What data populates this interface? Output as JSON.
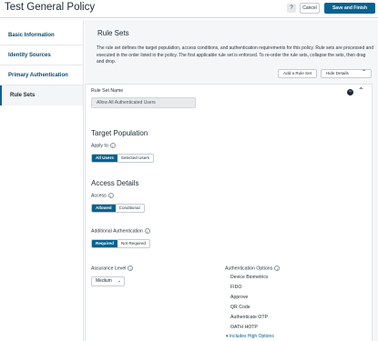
{
  "header": {
    "title": "Test General Policy",
    "help_label": "?",
    "cancel_label": "Cancel",
    "save_label": "Save and Finish"
  },
  "sidebar": {
    "items": [
      {
        "label": "Basic Information"
      },
      {
        "label": "Identity Sources"
      },
      {
        "label": "Primary Authentication"
      },
      {
        "label": "Rule Sets"
      }
    ],
    "active": "Rule Sets"
  },
  "main": {
    "title": "Rule Sets",
    "description": "The rule set defines the target population, access conditions, and authentication requirements for this policy. Rule sets are processed and executed in the order listed in the policy. The first applicable rule set is enforced. To re-order the rule sets, collapse the sets, then drag and drop.",
    "add_rule_set_label": "Add a Rule Set",
    "hide_details_label": "Hide Details"
  },
  "rule_set": {
    "name_label": "Rule Set Name",
    "name_value": "Allow All Authenticated Users",
    "target_population": {
      "heading": "Target Population",
      "apply_to_label": "Apply to",
      "options": [
        "All Users",
        "Selected Users"
      ],
      "selected": "All Users"
    },
    "access_details": {
      "heading": "Access Details",
      "access_label": "Access",
      "access_options": [
        "Allowed",
        "Conditional"
      ],
      "access_selected": "Allowed",
      "additional_auth_label": "Additional Authentication",
      "additional_auth_options": [
        "Required",
        "Not Required"
      ],
      "additional_auth_selected": "Required",
      "assurance_label": "Assurance Level",
      "assurance_value": "Medium",
      "auth_options_label": "Authentication Options",
      "auth_options": [
        "Device Biometrics",
        "FIDO",
        "Approve",
        "QR Code",
        "Authenticate OTP",
        "OATH HOTP"
      ],
      "more_options_label": "Includes High Options"
    }
  },
  "colors": {
    "accent": "#06628f",
    "panel_bg": "#f5f6f7",
    "link": "#0b5a8a"
  },
  "icons": {
    "help": "question-icon",
    "info": "info-icon",
    "collapse": "chevron-up-icon",
    "remove": "minus-circle-icon",
    "expand_more": "chevron-down-icon"
  }
}
